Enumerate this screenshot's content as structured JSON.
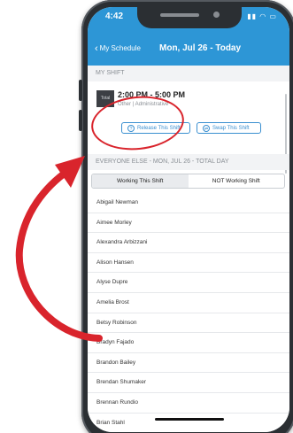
{
  "status_bar": {
    "time": "4:42",
    "icons": "▮▮ ◠ ▭"
  },
  "nav": {
    "back_label": "My Schedule",
    "title": "Mon, Jul 26 - Today"
  },
  "my_shift": {
    "header": "MY SHIFT",
    "thumb_label": "Total",
    "time": "2:00 PM - 5:00 PM",
    "role": "Other | Administrative",
    "release_label": "Release This Shift",
    "swap_label": "Swap This Shift"
  },
  "everyone_else": {
    "header": "EVERYONE ELSE - MON, JUL 26 - TOTAL DAY",
    "tabs": [
      {
        "label": "Working This Shift",
        "active": true
      },
      {
        "label": "NOT Working Shift",
        "active": false
      }
    ],
    "people": [
      "Abigail Newman",
      "Aimee Morley",
      "Alexandra Arbizzani",
      "Alison Hansen",
      "Alyse Dupre",
      "Amelia Brost",
      "Betsy Robinson",
      "Bradyn Fajado",
      "Brandon Bailey",
      "Brendan Shumaker",
      "Brennan Rundio",
      "Brian Stahl"
    ]
  },
  "colors": {
    "header_blue": "#2d96d6",
    "annotation_red": "#d9242c",
    "button_blue": "#3a8fd0"
  }
}
